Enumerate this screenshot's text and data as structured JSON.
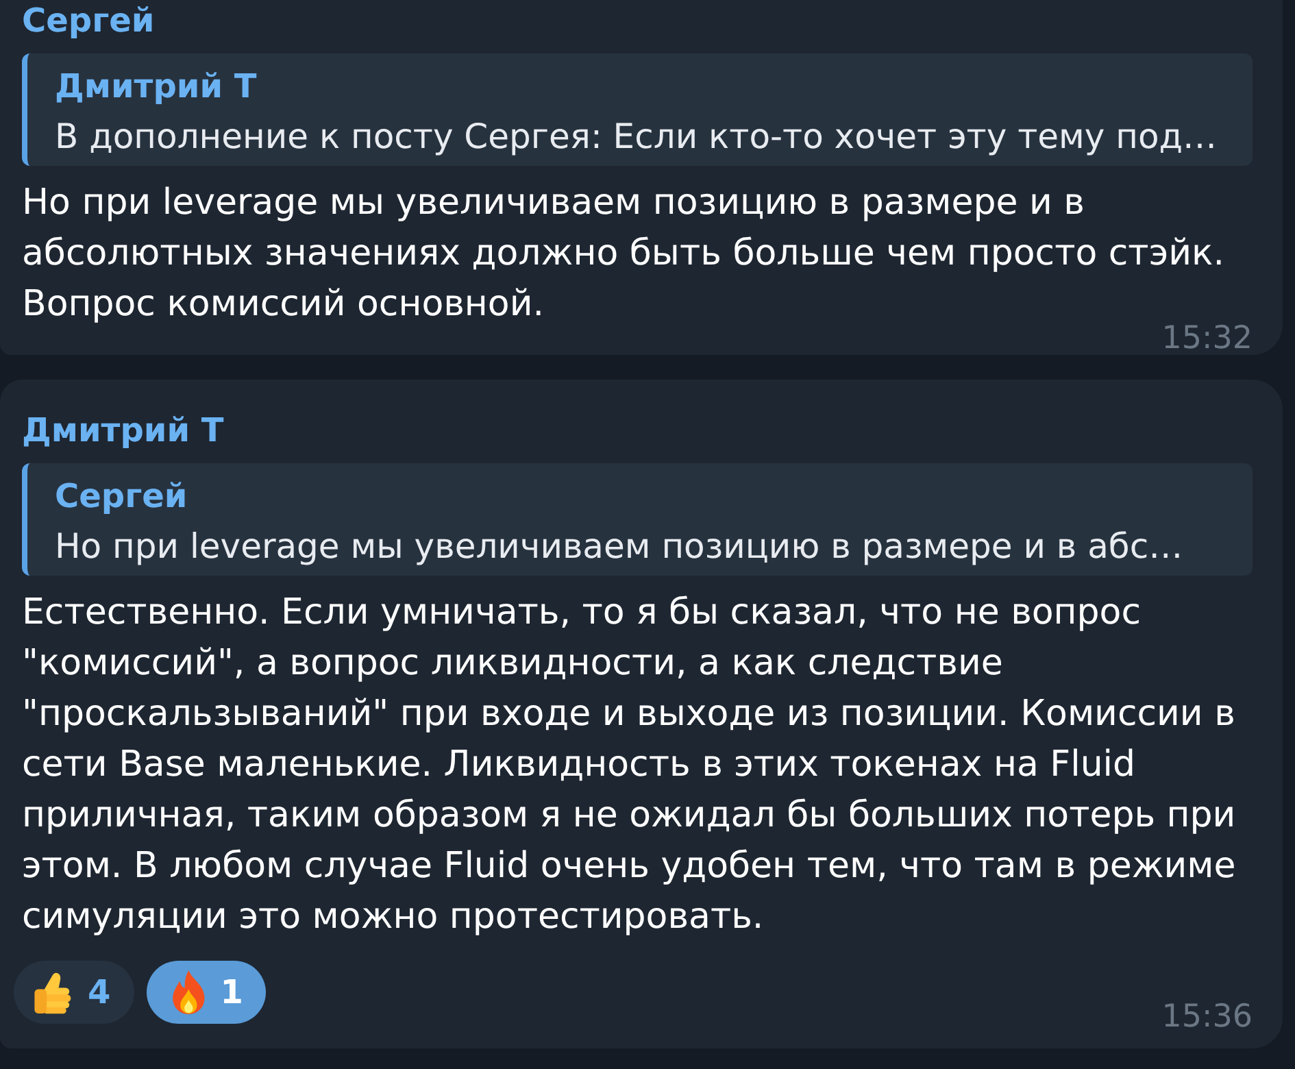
{
  "messages": [
    {
      "author": "Сергей",
      "reply": {
        "author": "Дмитрий Т",
        "text": "В дополнение к посту Сергея: Если кто-то хочет эту тему под…"
      },
      "text": "Но при leverage мы увеличиваем позицию в размере и в абсолютных значениях должно быть больше чем просто стэйк. Вопрос комиссий основной.",
      "time": "15:32"
    },
    {
      "author": "Дмитрий Т",
      "reply": {
        "author": "Сергей",
        "text": "Но при leverage мы увеличиваем позицию в размере и в абс…"
      },
      "text": "Естественно. Если умничать, то я бы сказал, что не вопрос \"комиссий\", а вопрос ликвидности, а как следствие \"проскальзываний\" при входе и выходе из позиции. Комиссии в сети Base маленькие. Ликвидность в этих токенах на Fluid приличная, таким образом я не ожидал бы больших потерь при этом. В любом случае Fluid очень удобен тем, что там в режиме симуляции это можно протестировать.",
      "reactions": [
        {
          "kind": "thumbs-up",
          "count": "4",
          "selected": false
        },
        {
          "kind": "fire",
          "count": "1",
          "selected": true
        }
      ],
      "time": "15:36"
    }
  ]
}
